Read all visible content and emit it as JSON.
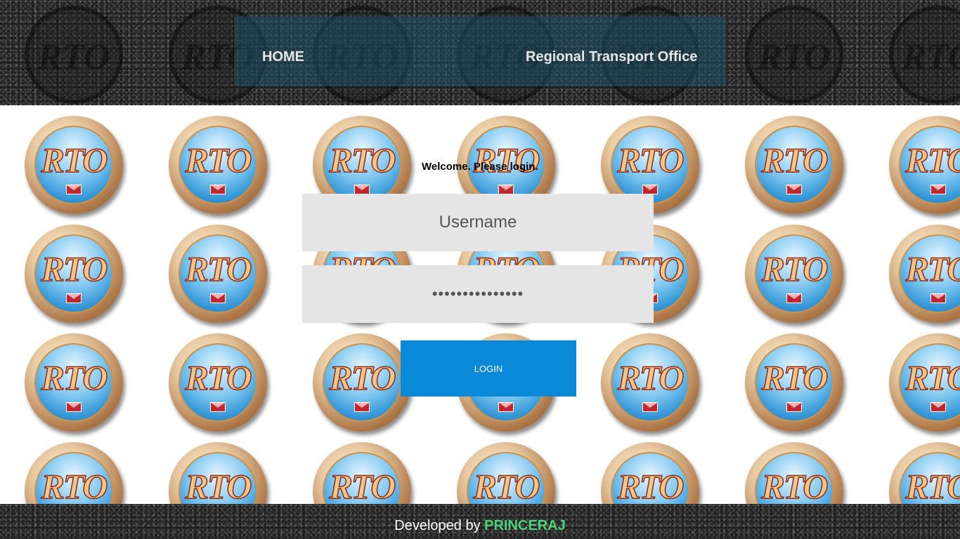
{
  "nav": {
    "home_label": "HOME",
    "site_title": "Regional Transport Office"
  },
  "logo_text": "RTO",
  "login": {
    "welcome": "Welcome. Please login.",
    "username_placeholder": "Username",
    "password_value": "•••••••••••••••",
    "button_label": "LOGIN"
  },
  "footer": {
    "prefix": "Developed by",
    "developer": "PRINCERAJ"
  },
  "colors": {
    "accent": "#0a89d9",
    "developer_name": "#4cd47a",
    "field_background": "#e5e5e5"
  }
}
